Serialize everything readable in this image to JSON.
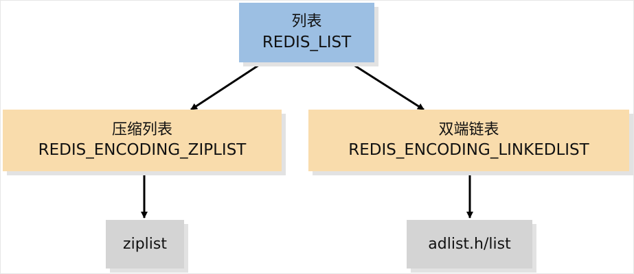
{
  "diagram": {
    "root": {
      "title": "列表",
      "name": "REDIS_LIST"
    },
    "encodings": [
      {
        "title": "压缩列表",
        "name": "REDIS_ENCODING_ZIPLIST",
        "impl": "ziplist"
      },
      {
        "title": "双端链表",
        "name": "REDIS_ENCODING_LINKEDLIST",
        "impl": "adlist.h/list"
      }
    ],
    "colors": {
      "root_fill": "#9cbfe3",
      "encoding_fill": "#f9dcac",
      "impl_fill": "#d4d4d4",
      "arrow": "#000000",
      "shadow": "#e2e2e2"
    }
  }
}
